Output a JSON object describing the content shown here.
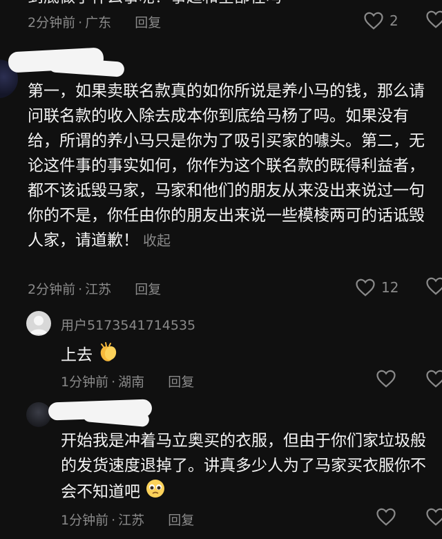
{
  "top_comment": {
    "partial_text": "到底做了什么事呢？事趋和全部在吗",
    "time": "2分钟前",
    "location": "广东",
    "reply_label": "回复",
    "likes": "2"
  },
  "comment1": {
    "text": "第一，如果卖联名款真的如你所说是养小马的钱，那么请问联名款的收入除去成本你到底给马杨了吗。如果没有给，所谓的养小马只是你为了吸引买家的噱头。第二，无论这件事的事实如何，你作为这个联名款的既得利益者，都不该诋毁马家，马家和他们的朋友从来没出来说过一句你的不是，你任由你的朋友出来说一些模棱两可的话诋毁人家，请道歉！",
    "collapse_label": "收起",
    "time": "2分钟前",
    "location": "江苏",
    "reply_label": "回复",
    "likes": "12"
  },
  "comment2": {
    "username": "用户5173541714535",
    "text": "上去",
    "emoji": "clapping-hands-emoji",
    "time": "1分钟前",
    "location": "湖南",
    "reply_label": "回复"
  },
  "comment3": {
    "text": "开始我是冲着马立奥买的衣服，但由于你们家垃圾般的发货速度退掉了。讲真多少人为了马家买衣服你不会不知道吧",
    "emoji": "pleading-face-emoji",
    "time": "1分钟前",
    "location": "江苏",
    "reply_label": "回复"
  },
  "colors": {
    "background": "#101010",
    "text": "#f4f4f4",
    "meta": "#8a8a8a"
  }
}
